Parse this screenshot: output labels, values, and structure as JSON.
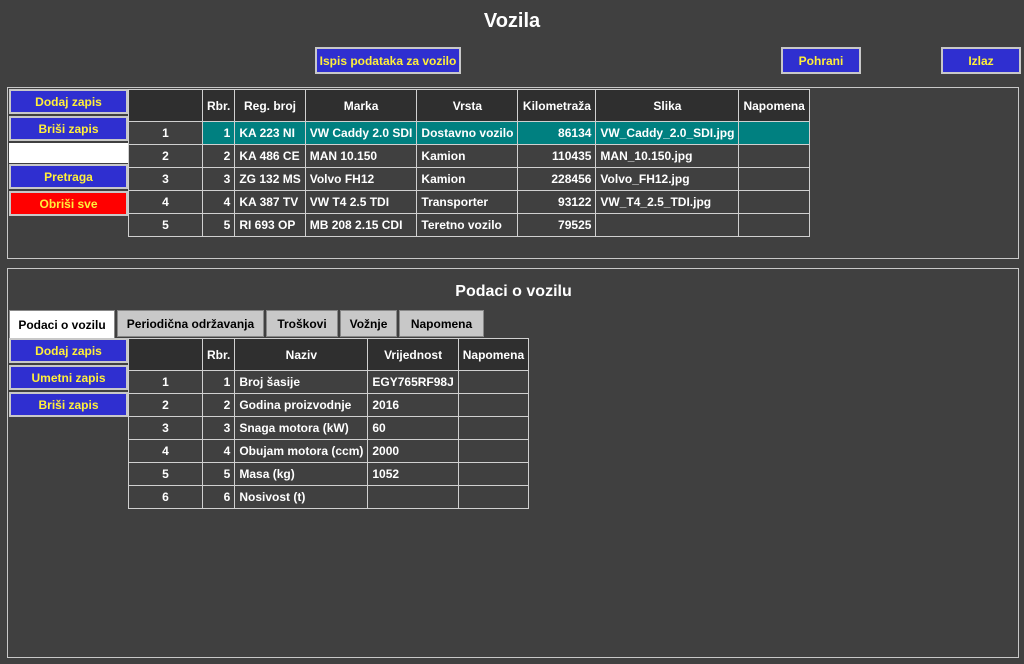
{
  "title": "Vozila",
  "toolbar": {
    "print_label": "Ispis podataka za vozilo",
    "save_label": "Pohrani",
    "exit_label": "Izlaz"
  },
  "vehicles_actions": {
    "add": "Dodaj zapis",
    "delete": "Briši zapis",
    "search": "Pretraga",
    "clear_all": "Obriši sve"
  },
  "vehicles_table": {
    "headers": [
      "",
      "Rbr.",
      "Reg. broj",
      "Marka",
      "Vrsta",
      "Kilometraža",
      "Slika",
      "Napomena"
    ],
    "rows": [
      [
        "1",
        "1",
        "KA 223 NI",
        "VW Caddy 2.0 SDI",
        "Dostavno vozilo",
        "86134",
        "VW_Caddy_2.0_SDI.jpg",
        ""
      ],
      [
        "2",
        "2",
        "KA 486 CE",
        "MAN 10.150",
        "Kamion",
        "110435",
        "MAN_10.150.jpg",
        ""
      ],
      [
        "3",
        "3",
        "ZG 132 MS",
        "Volvo FH12",
        "Kamion",
        "228456",
        "Volvo_FH12.jpg",
        ""
      ],
      [
        "4",
        "4",
        "KA 387 TV",
        "VW T4 2.5 TDI",
        "Transporter",
        "93122",
        "VW_T4_2.5_TDI.jpg",
        ""
      ],
      [
        "5",
        "5",
        "RI 693 OP",
        "MB 208 2.15 CDI",
        "Teretno vozilo",
        "79525",
        "",
        ""
      ]
    ],
    "selected_row": 0
  },
  "details": {
    "title": "Podaci o vozilu",
    "tabs": [
      "Podaci o vozilu",
      "Periodična održavanja",
      "Troškovi",
      "Vožnje",
      "Napomena"
    ],
    "active_tab": 0,
    "actions": {
      "add": "Dodaj zapis",
      "insert": "Umetni zapis",
      "delete": "Briši zapis"
    },
    "headers": [
      "",
      "Rbr.",
      "Naziv",
      "Vrijednost",
      "Napomena"
    ],
    "rows": [
      [
        "1",
        "1",
        "Broj šasije",
        "EGY765RF98J",
        ""
      ],
      [
        "2",
        "2",
        "Godina proizvodnje",
        "2016",
        ""
      ],
      [
        "3",
        "3",
        "Snaga motora (kW)",
        "60",
        ""
      ],
      [
        "4",
        "4",
        "Obujam motora (ccm)",
        "2000",
        ""
      ],
      [
        "5",
        "5",
        "Masa (kg)",
        "1052",
        ""
      ],
      [
        "6",
        "6",
        "Nosivost (t)",
        "",
        ""
      ]
    ]
  },
  "colors": {
    "background": "#404040",
    "button": "#2f2fd0",
    "button_text": "#ffef3a",
    "danger": "#ff0000",
    "selection": "#008080",
    "header": "#2f2f2f"
  }
}
